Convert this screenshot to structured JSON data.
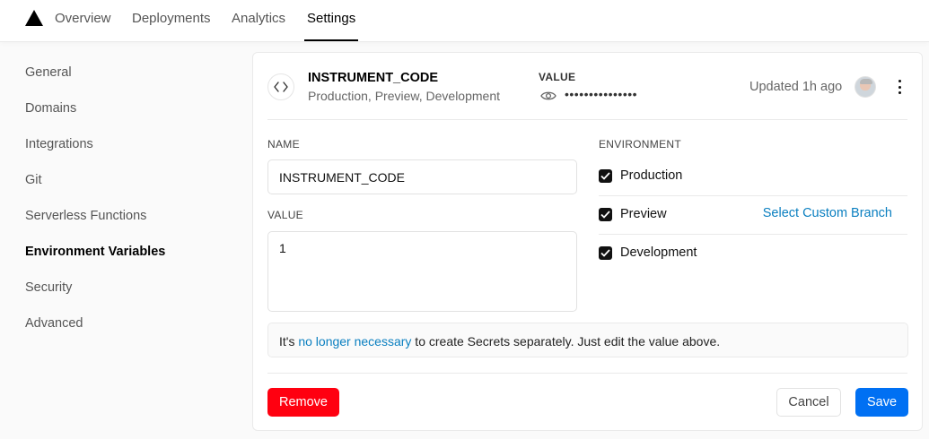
{
  "nav": {
    "tabs": [
      {
        "label": "Overview"
      },
      {
        "label": "Deployments"
      },
      {
        "label": "Analytics"
      },
      {
        "label": "Settings"
      }
    ]
  },
  "sidebar": {
    "items": [
      {
        "label": "General"
      },
      {
        "label": "Domains"
      },
      {
        "label": "Integrations"
      },
      {
        "label": "Git"
      },
      {
        "label": "Serverless Functions"
      },
      {
        "label": "Environment Variables"
      },
      {
        "label": "Security"
      },
      {
        "label": "Advanced"
      }
    ]
  },
  "variable": {
    "name": "INSTRUMENT_CODE",
    "environments_summary": "Production, Preview, Development",
    "value_label": "VALUE",
    "masked_value": "•••••••••••••••",
    "updated": "Updated 1h ago"
  },
  "form": {
    "name_label": "NAME",
    "name_value": "INSTRUMENT_CODE",
    "value_label": "VALUE",
    "value_value": "1",
    "environment_label": "ENVIRONMENT",
    "environments": [
      {
        "label": "Production",
        "checked": true
      },
      {
        "label": "Preview",
        "checked": true
      },
      {
        "label": "Development",
        "checked": true
      }
    ],
    "custom_branch_link": "Select Custom Branch"
  },
  "notice": {
    "prefix": "It's ",
    "link": "no longer necessary",
    "suffix": " to create Secrets separately. Just edit the value above."
  },
  "actions": {
    "remove": "Remove",
    "cancel": "Cancel",
    "save": "Save"
  },
  "colors": {
    "link": "#0a7fc0",
    "remove": "#ff0010",
    "save": "#0070f3"
  }
}
